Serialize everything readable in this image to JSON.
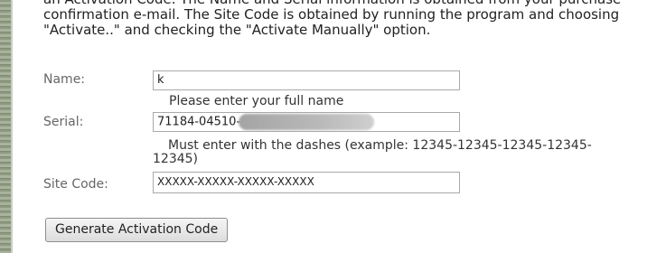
{
  "intro": {
    "line1": "an Activation Code. The Name and Serial information is obtained from your purchase",
    "line2": "confirmation e-mail. The Site Code is obtained by running the program and choosing",
    "line3": "\"Activate..\" and checking the \"Activate Manually\" option."
  },
  "form": {
    "name": {
      "label": "Name:",
      "value": "k",
      "hint": "Please enter your full name"
    },
    "serial": {
      "label": "Serial:",
      "value": "71184-04510-",
      "hint_line1": "Must enter with the dashes (example: 12345-12345-12345-12345-",
      "hint_line2": "12345)"
    },
    "site_code": {
      "label": "Site Code:",
      "value": "XXXXX-XXXXX-XXXXX-XXXXX"
    },
    "submit_label": "Generate Activation Code"
  }
}
